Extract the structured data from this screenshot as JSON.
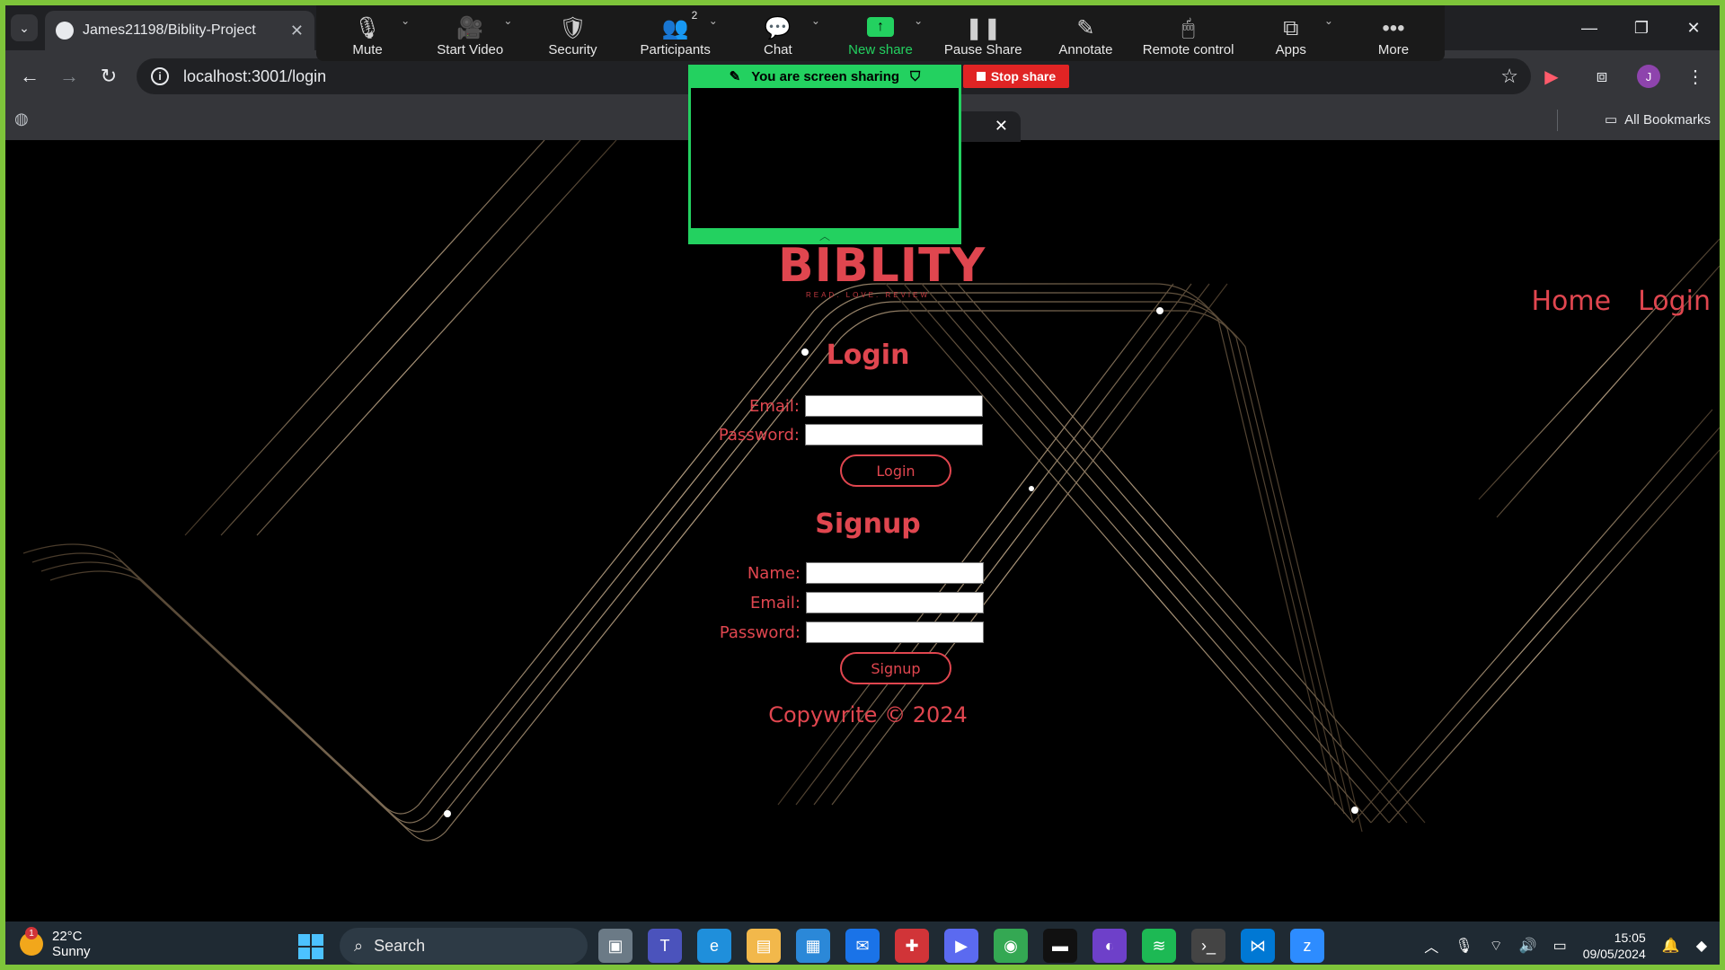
{
  "browser": {
    "tab_title": "James21198/Biblity-Project",
    "url": "localhost:3001/login",
    "all_bookmarks": "All Bookmarks",
    "avatar_initial": "J"
  },
  "zoom": {
    "items": [
      {
        "name": "mute",
        "label": "Mute",
        "icon": "🎙",
        "caret": true
      },
      {
        "name": "start-video",
        "label": "Start Video",
        "icon": "🎥",
        "caret": true
      },
      {
        "name": "security",
        "label": "Security",
        "icon": "🛡",
        "caret": false
      },
      {
        "name": "participants",
        "label": "Participants",
        "icon": "👥",
        "caret": true,
        "badge": "2"
      },
      {
        "name": "chat",
        "label": "Chat",
        "icon": "💬",
        "caret": true
      },
      {
        "name": "new-share",
        "label": "New share",
        "icon": "↑",
        "caret": true,
        "green": true
      },
      {
        "name": "pause-share",
        "label": "Pause Share",
        "icon": "❚❚",
        "caret": false
      },
      {
        "name": "annotate",
        "label": "Annotate",
        "icon": "✎",
        "caret": false
      },
      {
        "name": "remote-control",
        "label": "Remote control",
        "icon": "🖱",
        "caret": false
      },
      {
        "name": "apps",
        "label": "Apps",
        "icon": "⧉",
        "caret": true
      },
      {
        "name": "more",
        "label": "More",
        "icon": "•••",
        "caret": false
      }
    ],
    "sharing_banner": "You are screen sharing",
    "stop_share": "Stop share"
  },
  "site": {
    "logo": "BIBLITY",
    "tagline": "READ. LOVE. REVIEW",
    "nav": [
      "Home",
      "Login"
    ],
    "login": {
      "title": "Login",
      "email_label": "Email:",
      "password_label": "Password:",
      "button": "Login"
    },
    "signup": {
      "title": "Signup",
      "name_label": "Name:",
      "email_label": "Email:",
      "password_label": "Password:",
      "button": "Signup"
    },
    "footer": "Copywrite © 2024"
  },
  "taskbar": {
    "temperature": "22°C",
    "condition": "Sunny",
    "weather_badge": "1",
    "search": "Search",
    "time": "15:05",
    "date": "09/05/2024"
  },
  "colors": {
    "accent": "#e0464f",
    "zoom_green": "#23d160",
    "frame": "#7ec43a"
  }
}
